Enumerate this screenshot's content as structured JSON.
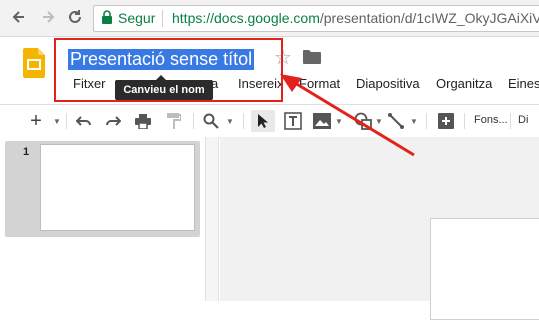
{
  "browser": {
    "secure_label": "Segur",
    "url_scheme_host": "https://docs.google.com",
    "url_path": "/presentation/d/1cIWZ_OkyJGAiXiV"
  },
  "doc": {
    "title": "Presentació sense títol",
    "tooltip": "Canvieu el nom"
  },
  "menu": {
    "items": [
      "Fitxer",
      "a",
      "Insereix",
      "Format",
      "Diapositiva",
      "Organitza",
      "Eines"
    ]
  },
  "toolbar": {
    "theme_label": "Fons...",
    "cut_label": "Di"
  },
  "filmstrip": {
    "slide_number": "1"
  },
  "colors": {
    "annotation": "#e3231b",
    "selection": "#3879e4",
    "logo": "#f4b400",
    "secure": "#0b8043"
  },
  "icons": [
    "back-icon",
    "forward-icon",
    "reload-icon",
    "lock-icon",
    "slides-logo-icon",
    "star-icon",
    "folder-icon",
    "add-icon",
    "undo-icon",
    "redo-icon",
    "print-icon",
    "paint-format-icon",
    "zoom-icon",
    "select-icon",
    "textbox-icon",
    "image-icon",
    "shape-icon",
    "line-icon",
    "comment-icon"
  ]
}
